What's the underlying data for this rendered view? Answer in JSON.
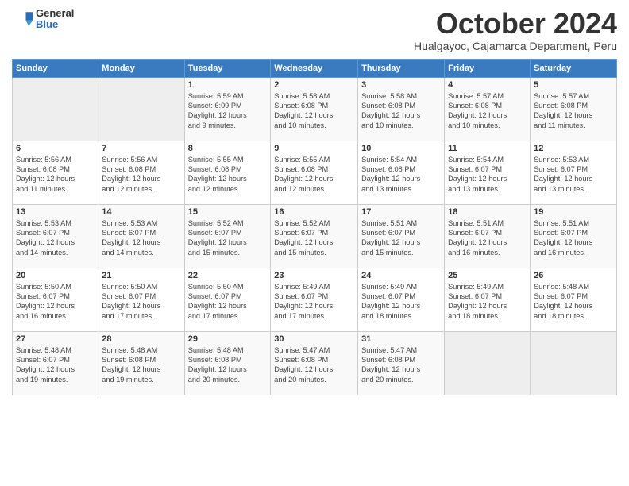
{
  "logo": {
    "general": "General",
    "blue": "Blue"
  },
  "header": {
    "month": "October 2024",
    "location": "Hualgayoc, Cajamarca Department, Peru"
  },
  "weekdays": [
    "Sunday",
    "Monday",
    "Tuesday",
    "Wednesday",
    "Thursday",
    "Friday",
    "Saturday"
  ],
  "weeks": [
    [
      {
        "day": "",
        "info": ""
      },
      {
        "day": "",
        "info": ""
      },
      {
        "day": "1",
        "info": "Sunrise: 5:59 AM\nSunset: 6:09 PM\nDaylight: 12 hours\nand 9 minutes."
      },
      {
        "day": "2",
        "info": "Sunrise: 5:58 AM\nSunset: 6:08 PM\nDaylight: 12 hours\nand 10 minutes."
      },
      {
        "day": "3",
        "info": "Sunrise: 5:58 AM\nSunset: 6:08 PM\nDaylight: 12 hours\nand 10 minutes."
      },
      {
        "day": "4",
        "info": "Sunrise: 5:57 AM\nSunset: 6:08 PM\nDaylight: 12 hours\nand 10 minutes."
      },
      {
        "day": "5",
        "info": "Sunrise: 5:57 AM\nSunset: 6:08 PM\nDaylight: 12 hours\nand 11 minutes."
      }
    ],
    [
      {
        "day": "6",
        "info": "Sunrise: 5:56 AM\nSunset: 6:08 PM\nDaylight: 12 hours\nand 11 minutes."
      },
      {
        "day": "7",
        "info": "Sunrise: 5:56 AM\nSunset: 6:08 PM\nDaylight: 12 hours\nand 12 minutes."
      },
      {
        "day": "8",
        "info": "Sunrise: 5:55 AM\nSunset: 6:08 PM\nDaylight: 12 hours\nand 12 minutes."
      },
      {
        "day": "9",
        "info": "Sunrise: 5:55 AM\nSunset: 6:08 PM\nDaylight: 12 hours\nand 12 minutes."
      },
      {
        "day": "10",
        "info": "Sunrise: 5:54 AM\nSunset: 6:08 PM\nDaylight: 12 hours\nand 13 minutes."
      },
      {
        "day": "11",
        "info": "Sunrise: 5:54 AM\nSunset: 6:07 PM\nDaylight: 12 hours\nand 13 minutes."
      },
      {
        "day": "12",
        "info": "Sunrise: 5:53 AM\nSunset: 6:07 PM\nDaylight: 12 hours\nand 13 minutes."
      }
    ],
    [
      {
        "day": "13",
        "info": "Sunrise: 5:53 AM\nSunset: 6:07 PM\nDaylight: 12 hours\nand 14 minutes."
      },
      {
        "day": "14",
        "info": "Sunrise: 5:53 AM\nSunset: 6:07 PM\nDaylight: 12 hours\nand 14 minutes."
      },
      {
        "day": "15",
        "info": "Sunrise: 5:52 AM\nSunset: 6:07 PM\nDaylight: 12 hours\nand 15 minutes."
      },
      {
        "day": "16",
        "info": "Sunrise: 5:52 AM\nSunset: 6:07 PM\nDaylight: 12 hours\nand 15 minutes."
      },
      {
        "day": "17",
        "info": "Sunrise: 5:51 AM\nSunset: 6:07 PM\nDaylight: 12 hours\nand 15 minutes."
      },
      {
        "day": "18",
        "info": "Sunrise: 5:51 AM\nSunset: 6:07 PM\nDaylight: 12 hours\nand 16 minutes."
      },
      {
        "day": "19",
        "info": "Sunrise: 5:51 AM\nSunset: 6:07 PM\nDaylight: 12 hours\nand 16 minutes."
      }
    ],
    [
      {
        "day": "20",
        "info": "Sunrise: 5:50 AM\nSunset: 6:07 PM\nDaylight: 12 hours\nand 16 minutes."
      },
      {
        "day": "21",
        "info": "Sunrise: 5:50 AM\nSunset: 6:07 PM\nDaylight: 12 hours\nand 17 minutes."
      },
      {
        "day": "22",
        "info": "Sunrise: 5:50 AM\nSunset: 6:07 PM\nDaylight: 12 hours\nand 17 minutes."
      },
      {
        "day": "23",
        "info": "Sunrise: 5:49 AM\nSunset: 6:07 PM\nDaylight: 12 hours\nand 17 minutes."
      },
      {
        "day": "24",
        "info": "Sunrise: 5:49 AM\nSunset: 6:07 PM\nDaylight: 12 hours\nand 18 minutes."
      },
      {
        "day": "25",
        "info": "Sunrise: 5:49 AM\nSunset: 6:07 PM\nDaylight: 12 hours\nand 18 minutes."
      },
      {
        "day": "26",
        "info": "Sunrise: 5:48 AM\nSunset: 6:07 PM\nDaylight: 12 hours\nand 18 minutes."
      }
    ],
    [
      {
        "day": "27",
        "info": "Sunrise: 5:48 AM\nSunset: 6:07 PM\nDaylight: 12 hours\nand 19 minutes."
      },
      {
        "day": "28",
        "info": "Sunrise: 5:48 AM\nSunset: 6:08 PM\nDaylight: 12 hours\nand 19 minutes."
      },
      {
        "day": "29",
        "info": "Sunrise: 5:48 AM\nSunset: 6:08 PM\nDaylight: 12 hours\nand 20 minutes."
      },
      {
        "day": "30",
        "info": "Sunrise: 5:47 AM\nSunset: 6:08 PM\nDaylight: 12 hours\nand 20 minutes."
      },
      {
        "day": "31",
        "info": "Sunrise: 5:47 AM\nSunset: 6:08 PM\nDaylight: 12 hours\nand 20 minutes."
      },
      {
        "day": "",
        "info": ""
      },
      {
        "day": "",
        "info": ""
      }
    ]
  ]
}
